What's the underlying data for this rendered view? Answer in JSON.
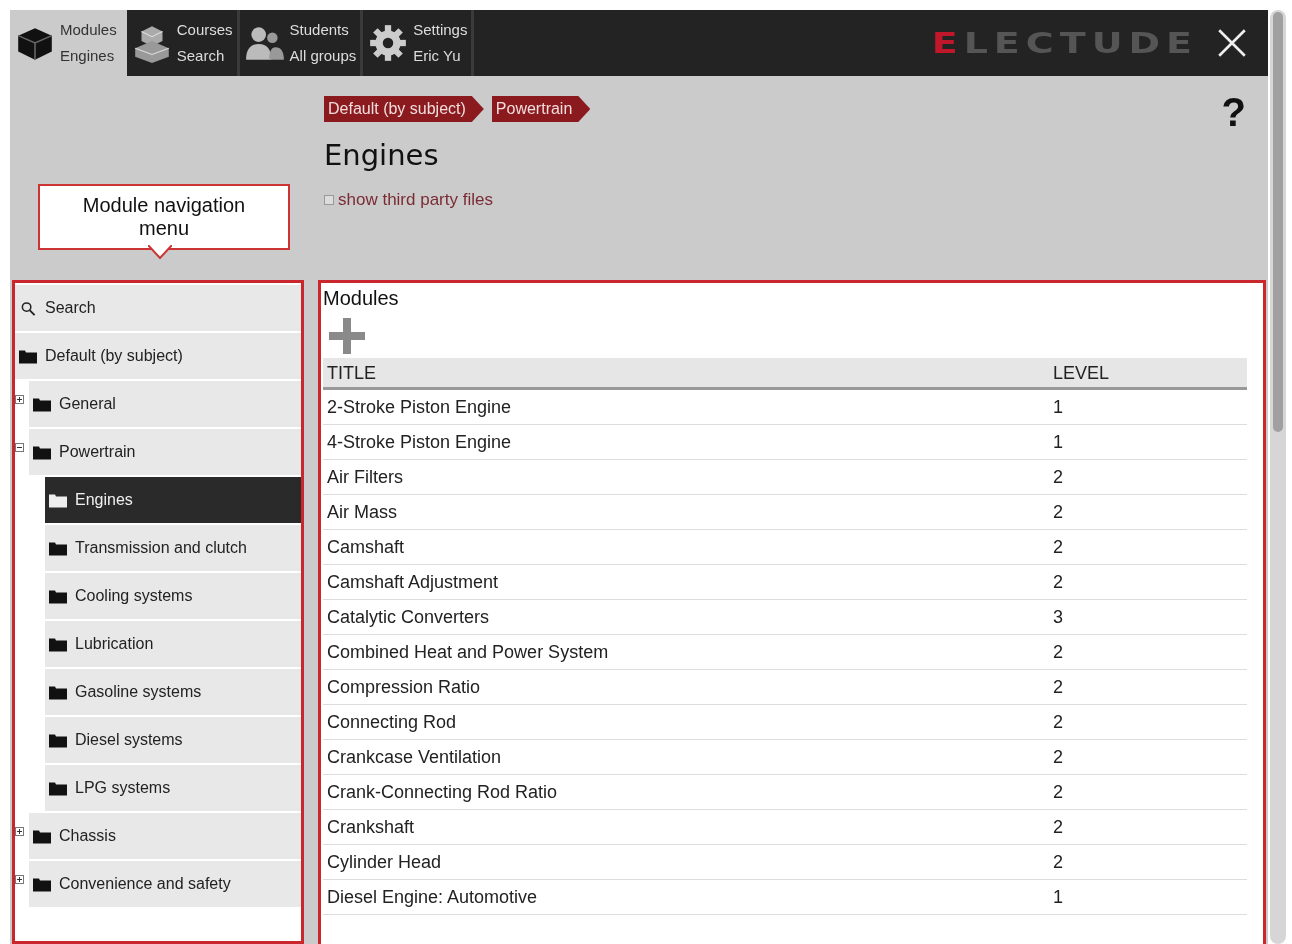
{
  "nav_tabs": [
    {
      "kind": "modules",
      "title": "Modules",
      "subtitle": "Engines",
      "selected": true
    },
    {
      "kind": "courses",
      "title": "Courses",
      "subtitle": "Search",
      "selected": false
    },
    {
      "kind": "students",
      "title": "Students",
      "subtitle": "All groups",
      "selected": false
    },
    {
      "kind": "settings",
      "title": "Settings",
      "subtitle": "Eric Yu",
      "selected": false
    }
  ],
  "logo": "ELECTUDE",
  "callout": "Module navigation menu",
  "breadcrumbs": [
    "Default (by subject)",
    "Powertrain"
  ],
  "page_title": "Engines",
  "help": "?",
  "third_party": {
    "label": "show third party files",
    "checked": false
  },
  "tree": [
    {
      "kind": "search",
      "label": "Search"
    },
    {
      "kind": "folder",
      "label": "Default (by subject)",
      "selected": false,
      "children": [
        {
          "label": "General",
          "selected": false,
          "expanded": false
        },
        {
          "label": "Powertrain",
          "selected": false,
          "expanded": true,
          "children": [
            {
              "label": "Engines",
              "selected": true
            },
            {
              "label": "Transmission and clutch",
              "selected": false
            },
            {
              "label": "Cooling systems",
              "selected": false
            },
            {
              "label": "Lubrication",
              "selected": false
            },
            {
              "label": "Gasoline systems",
              "selected": false
            },
            {
              "label": "Diesel systems",
              "selected": false
            },
            {
              "label": "LPG systems",
              "selected": false
            }
          ]
        },
        {
          "label": "Chassis",
          "selected": false,
          "expanded": false
        },
        {
          "label": "Convenience and safety",
          "selected": false,
          "expanded": false
        }
      ]
    }
  ],
  "modules": {
    "heading": "Modules",
    "columns": [
      "TITLE",
      "LEVEL"
    ],
    "rows": [
      [
        "2-Stroke Piston Engine",
        "1"
      ],
      [
        "4-Stroke Piston Engine",
        "1"
      ],
      [
        "Air Filters",
        "2"
      ],
      [
        "Air Mass",
        "2"
      ],
      [
        "Camshaft",
        "2"
      ],
      [
        "Camshaft Adjustment",
        "2"
      ],
      [
        "Catalytic Converters",
        "3"
      ],
      [
        "Combined Heat and Power System",
        "2"
      ],
      [
        "Compression Ratio",
        "2"
      ],
      [
        "Connecting Rod",
        "2"
      ],
      [
        "Crankcase Ventilation",
        "2"
      ],
      [
        "Crank-Connecting Rod Ratio",
        "2"
      ],
      [
        "Crankshaft",
        "2"
      ],
      [
        "Cylinder Head",
        "2"
      ],
      [
        "Diesel Engine: Automotive",
        "1"
      ]
    ]
  }
}
